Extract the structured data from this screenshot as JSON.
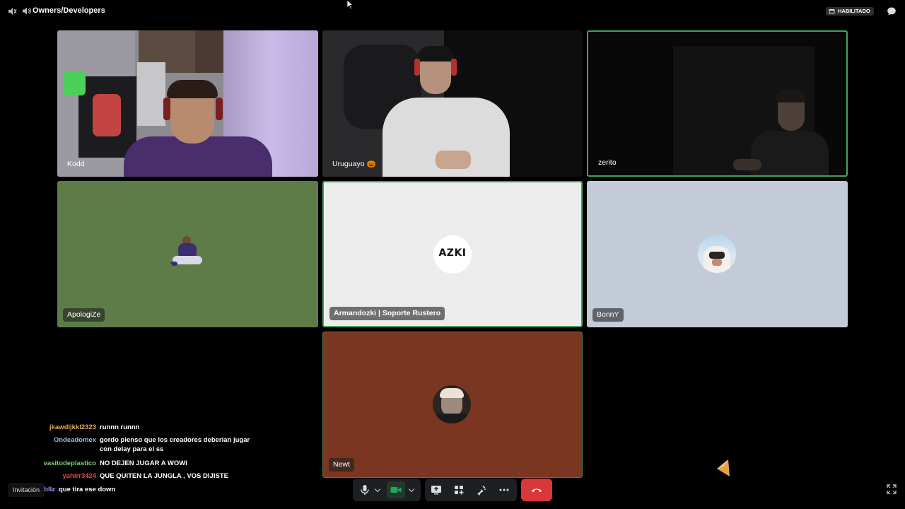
{
  "channel": {
    "title": "Owners/Developers",
    "status_badge": "HABILITADO"
  },
  "participants": [
    {
      "name": "Kodd",
      "type": "video"
    },
    {
      "name": "Uruguayo",
      "emoji": "🎃",
      "type": "video"
    },
    {
      "name": "zerito",
      "type": "video",
      "speaking": true
    },
    {
      "name": "ApologiZe",
      "type": "avatar",
      "bg": "#5e7c47"
    },
    {
      "name": "Armandozki | Soporte Rustero",
      "type": "avatar",
      "bg": "#ececec",
      "avatar_text": "AZKI",
      "speaking": true
    },
    {
      "name": "BonnY",
      "type": "avatar",
      "bg": "#c3cad8"
    },
    {
      "name": "Newt",
      "type": "avatar",
      "bg": "#7a3620"
    }
  ],
  "chat": [
    {
      "user": "jkawdljkkl2323",
      "color": "#e0a85a",
      "text": "runnn runnn"
    },
    {
      "user": "Ondeadomex",
      "color": "#9fb8e8",
      "text": "gordo pienso que los creadores deberian jugar con delay para el ss"
    },
    {
      "user": "vasitodeplastico",
      "color": "#7bd16a",
      "text": "NO DEJEN JUGAR A WOWI"
    },
    {
      "user": "yahirr3424",
      "color": "#e04b4b",
      "text": "QUE QUITEN LA JUNGLA , VOS DIJISTE"
    },
    {
      "user": "anbllz",
      "color": "#b890f0",
      "text": "que tira ese down"
    }
  ],
  "invite_label": "Invitación",
  "controls": {
    "mic_icon": "microphone-icon",
    "camera_icon": "camera-icon",
    "screen_icon": "screen-share-icon",
    "activities_icon": "activities-icon",
    "soundboard_icon": "soundboard-icon",
    "more_icon": "more-icon",
    "end_call_icon": "phone-hangup-icon",
    "camera_color": "#23a55a",
    "end_call_color": "#da373c"
  }
}
